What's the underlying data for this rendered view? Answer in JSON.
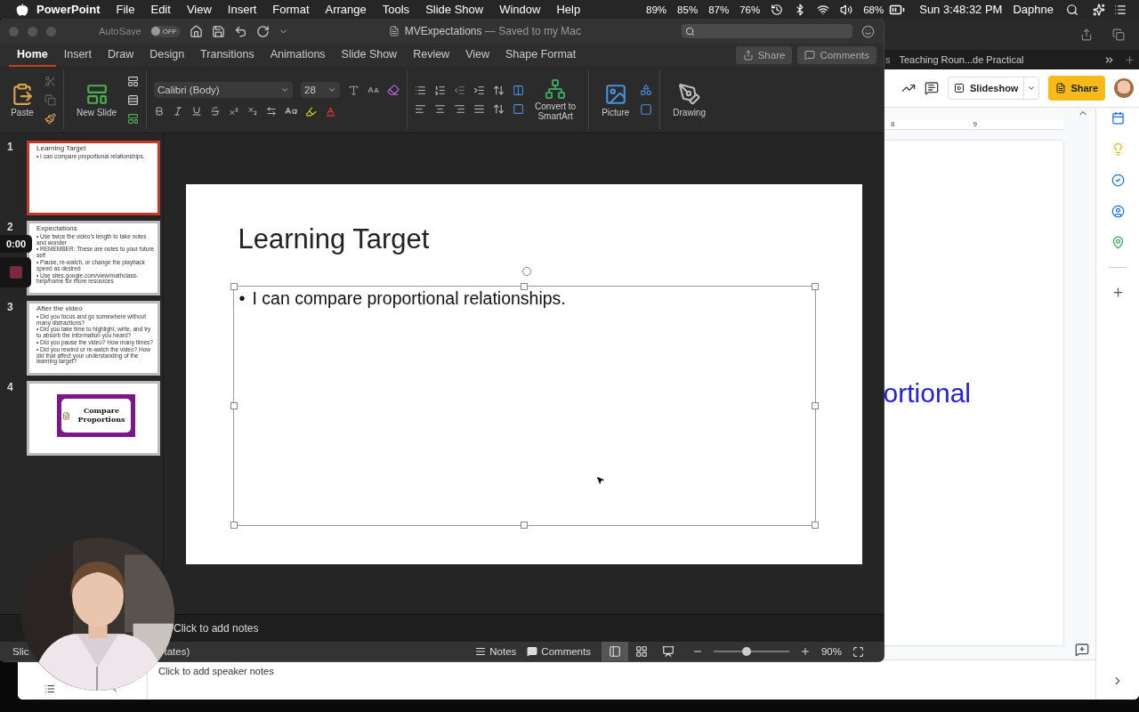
{
  "menubar": {
    "app": "PowerPoint",
    "menus": [
      "File",
      "Edit",
      "View",
      "Insert",
      "Format",
      "Arrange",
      "Tools",
      "Slide Show",
      "Window",
      "Help"
    ],
    "meters": [
      "89%",
      "85%",
      "87%",
      "76%"
    ],
    "battery": "68%",
    "clock": "Sun 3:48:32 PM",
    "user": "Daphne"
  },
  "browser": {
    "tab_fragment": "s",
    "tab": "Teaching Roun...de Practical",
    "slideshow_button": "Slideshow",
    "share_button": "Share",
    "ruler": [
      "8",
      "9"
    ],
    "slide_text": "ortional",
    "notes_placeholder": "Click to add speaker notes"
  },
  "powerpoint": {
    "autosave": {
      "label": "AutoSave",
      "state": "OFF",
      "on": false
    },
    "title": "MVExpectations",
    "subtitle": "— Saved to my Mac",
    "tabs": [
      {
        "label": "Home",
        "selected": true
      },
      {
        "label": "Insert",
        "selected": false
      },
      {
        "label": "Draw",
        "selected": false
      },
      {
        "label": "Design",
        "selected": false
      },
      {
        "label": "Transitions",
        "selected": false
      },
      {
        "label": "Animations",
        "selected": false
      },
      {
        "label": "Slide Show",
        "selected": false
      },
      {
        "label": "Review",
        "selected": false
      },
      {
        "label": "View",
        "selected": false
      },
      {
        "label": "Shape Format",
        "selected": false
      }
    ],
    "share_button": "Share",
    "comments_button": "Comments",
    "ribbon": {
      "paste": "Paste",
      "new_slide": "New Slide",
      "font": "Calibri (Body)",
      "size": "28",
      "smartart": "Convert to SmartArt",
      "picture": "Picture",
      "drawing": "Drawing"
    },
    "thumbnails": [
      {
        "number": "1",
        "kind": "text",
        "selected": true,
        "title": "Learning Target",
        "bullets": [
          "• I can compare proportional relationships."
        ]
      },
      {
        "number": "2",
        "kind": "text",
        "selected": false,
        "title": "Expectations",
        "bullets": [
          "• Use twice the video's length to take notes and wonder",
          "• REMEMBER: These are notes to your future self",
          "• Pause, re-watch, or change the playback speed as desired",
          "• Use sites.google.com/view/mathclass-help/home for more resources"
        ]
      },
      {
        "number": "3",
        "kind": "text",
        "selected": false,
        "title": "After the video",
        "bullets": [
          "• Did you focus and go somewhere without many distractions?",
          "• Did you take time to highlight, write, and try to absorb the information you heard?",
          "• Did you pause the video? How many times?",
          "• Did you rewind or re-watch the video? How did that affect your understanding of the learning target?"
        ]
      },
      {
        "number": "4",
        "kind": "card",
        "selected": false,
        "title": "Compare Proportions"
      }
    ],
    "slide": {
      "title": "Learning Target",
      "marker": "•",
      "text": "I can compare proportional relationships."
    },
    "notes_placeholder": "Click to add notes",
    "status": {
      "left_fragment": "Slic",
      "right_fragment": "tates)",
      "notes": "Notes",
      "comments": "Comments",
      "views": [
        {
          "kind": "normal",
          "selected": true
        },
        {
          "kind": "sorter",
          "selected": false
        },
        {
          "kind": "reading",
          "selected": false
        }
      ],
      "zoom_slider": {
        "level": 0.44
      },
      "zoom": "90%"
    }
  },
  "recorder": {
    "time": "0:00"
  }
}
